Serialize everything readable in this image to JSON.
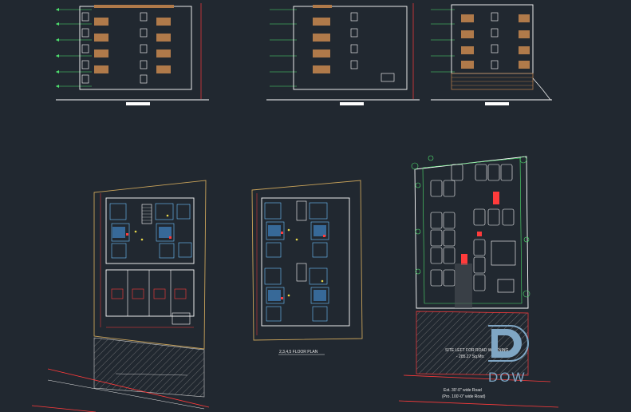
{
  "drawing": {
    "background": "#212830",
    "labels": {
      "floor_plan": "2,3,4,5 FLOOR PLAN",
      "site_left": "SITE LEFT FOR ROAD WIDENING",
      "site_left_area": "- 285.27 Sq.Mtr.",
      "road_a": "Ext. 30'-0\" wide Road",
      "road_b": "(Pro. 100'-0\" wide Road)"
    },
    "colors": {
      "frame": "#e6e6e6",
      "plot_boundary": "#c9a35a",
      "wall": "#ffffff",
      "room": "#6fc3ff",
      "level": "#4fe36f",
      "dimension": "#ff3b3b",
      "balcony": "#b07a4a",
      "yellow": "#e7d84a"
    }
  },
  "logo": {
    "text": "DOW",
    "color": "#7fa6c4"
  }
}
